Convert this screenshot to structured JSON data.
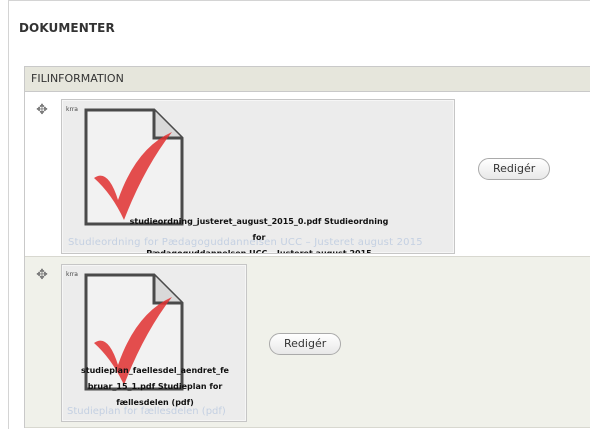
{
  "section": {
    "title": "DOKUMENTER"
  },
  "table": {
    "header": "FILINFORMATION"
  },
  "rows": [
    {
      "icon_label": "krra",
      "caption_line1": "studieordning_justeret_august_2015_0.pdf Studieordning for",
      "caption_line2": "Pædagoguddannelsen UCC – Justeret august 2015",
      "faded_text": "Studieordning for Pædagoguddannelsen UCC – Justeret august 2015",
      "edit_label": "Redigér"
    },
    {
      "icon_label": "krra",
      "caption_line1": "studieplan_faellesdel_aendret_fe",
      "caption_line2": "bruar_15_1.pdf Studieplan for",
      "caption_line3": "fællesdelen (pdf)",
      "faded_text": "Studieplan for fællesdelen (pdf)",
      "edit_label": "Redigér"
    }
  ],
  "icons": {
    "drag": "drag-handle-icon",
    "file": "pdf-file-icon"
  },
  "colors": {
    "header_bg": "#e6e6dc",
    "row2_bg": "#f0f1ea",
    "pdf_red": "#e03030"
  }
}
